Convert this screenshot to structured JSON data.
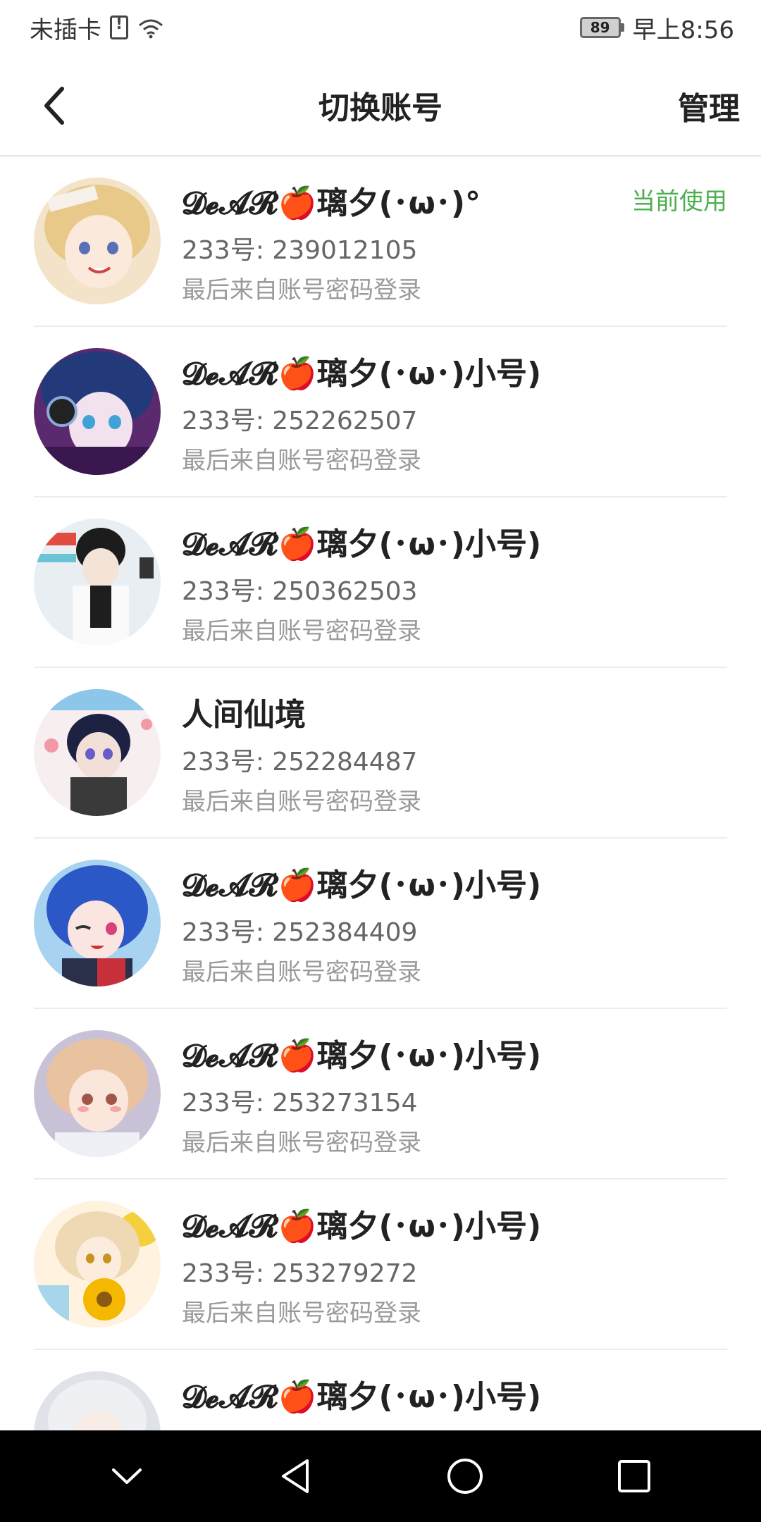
{
  "status_bar": {
    "carrier": "未插卡",
    "battery": "89",
    "time": "早上8:56"
  },
  "header": {
    "title": "切换账号",
    "manage_label": "管理",
    "back_icon": "chevron-left-icon"
  },
  "colors": {
    "accent_green": "#4caf50",
    "nav_bg": "#000000"
  },
  "accounts": [
    {
      "name": "𝓓𝓮𝓐𝓡🍎璃夕(･ω･)°",
      "id_label": "233号: 239012105",
      "login": "最后来自账号密码登录",
      "badge": "当前使用"
    },
    {
      "name": "𝓓𝓮𝓐𝓡🍎璃夕(･ω･)小号)",
      "id_label": "233号: 252262507",
      "login": "最后来自账号密码登录"
    },
    {
      "name": "𝓓𝓮𝓐𝓡🍎璃夕(･ω･)小号)",
      "id_label": "233号: 250362503",
      "login": "最后来自账号密码登录"
    },
    {
      "name": "人间仙境",
      "id_label": "233号: 252284487",
      "login": "最后来自账号密码登录"
    },
    {
      "name": "𝓓𝓮𝓐𝓡🍎璃夕(･ω･)小号)",
      "id_label": "233号: 252384409",
      "login": "最后来自账号密码登录"
    },
    {
      "name": "𝓓𝓮𝓐𝓡🍎璃夕(･ω･)小号)",
      "id_label": "233号: 253273154",
      "login": "最后来自账号密码登录"
    },
    {
      "name": "𝓓𝓮𝓐𝓡🍎璃夕(･ω･)小号)",
      "id_label": "233号: 253279272",
      "login": "最后来自账号密码登录"
    },
    {
      "name": "𝓓𝓮𝓐𝓡🍎璃夕(･ω･)小号)",
      "id_label": "",
      "login": ""
    }
  ],
  "nav_bar": {
    "icons": [
      "chevron-down-icon",
      "back-triangle-icon",
      "home-circle-icon",
      "recents-square-icon"
    ]
  }
}
